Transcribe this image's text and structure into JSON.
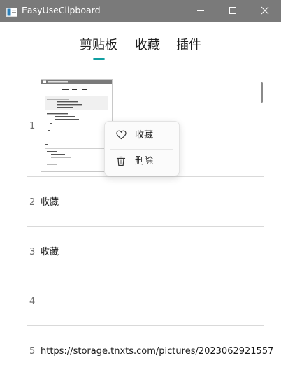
{
  "window": {
    "title": "EasyUseClipboard",
    "minimize_icon": "minimize-icon",
    "maximize_icon": "maximize-icon",
    "close_icon": "close-icon"
  },
  "tabs": [
    {
      "label": "剪贴板",
      "selected": true
    },
    {
      "label": "收藏",
      "selected": false
    },
    {
      "label": "插件",
      "selected": false
    }
  ],
  "accent_color": "#0f9fa1",
  "items": [
    {
      "index": "1",
      "type": "image",
      "text": ""
    },
    {
      "index": "2",
      "type": "text",
      "text": "收藏"
    },
    {
      "index": "3",
      "type": "text",
      "text": "收藏"
    },
    {
      "index": "4",
      "type": "text",
      "text": ""
    },
    {
      "index": "5",
      "type": "text",
      "text": "https://storage.tnxts.com/pictures/2023062921557"
    }
  ],
  "context_menu": {
    "items": [
      {
        "label": "收藏",
        "icon": "heart-icon"
      },
      {
        "label": "删除",
        "icon": "trash-icon"
      }
    ]
  }
}
